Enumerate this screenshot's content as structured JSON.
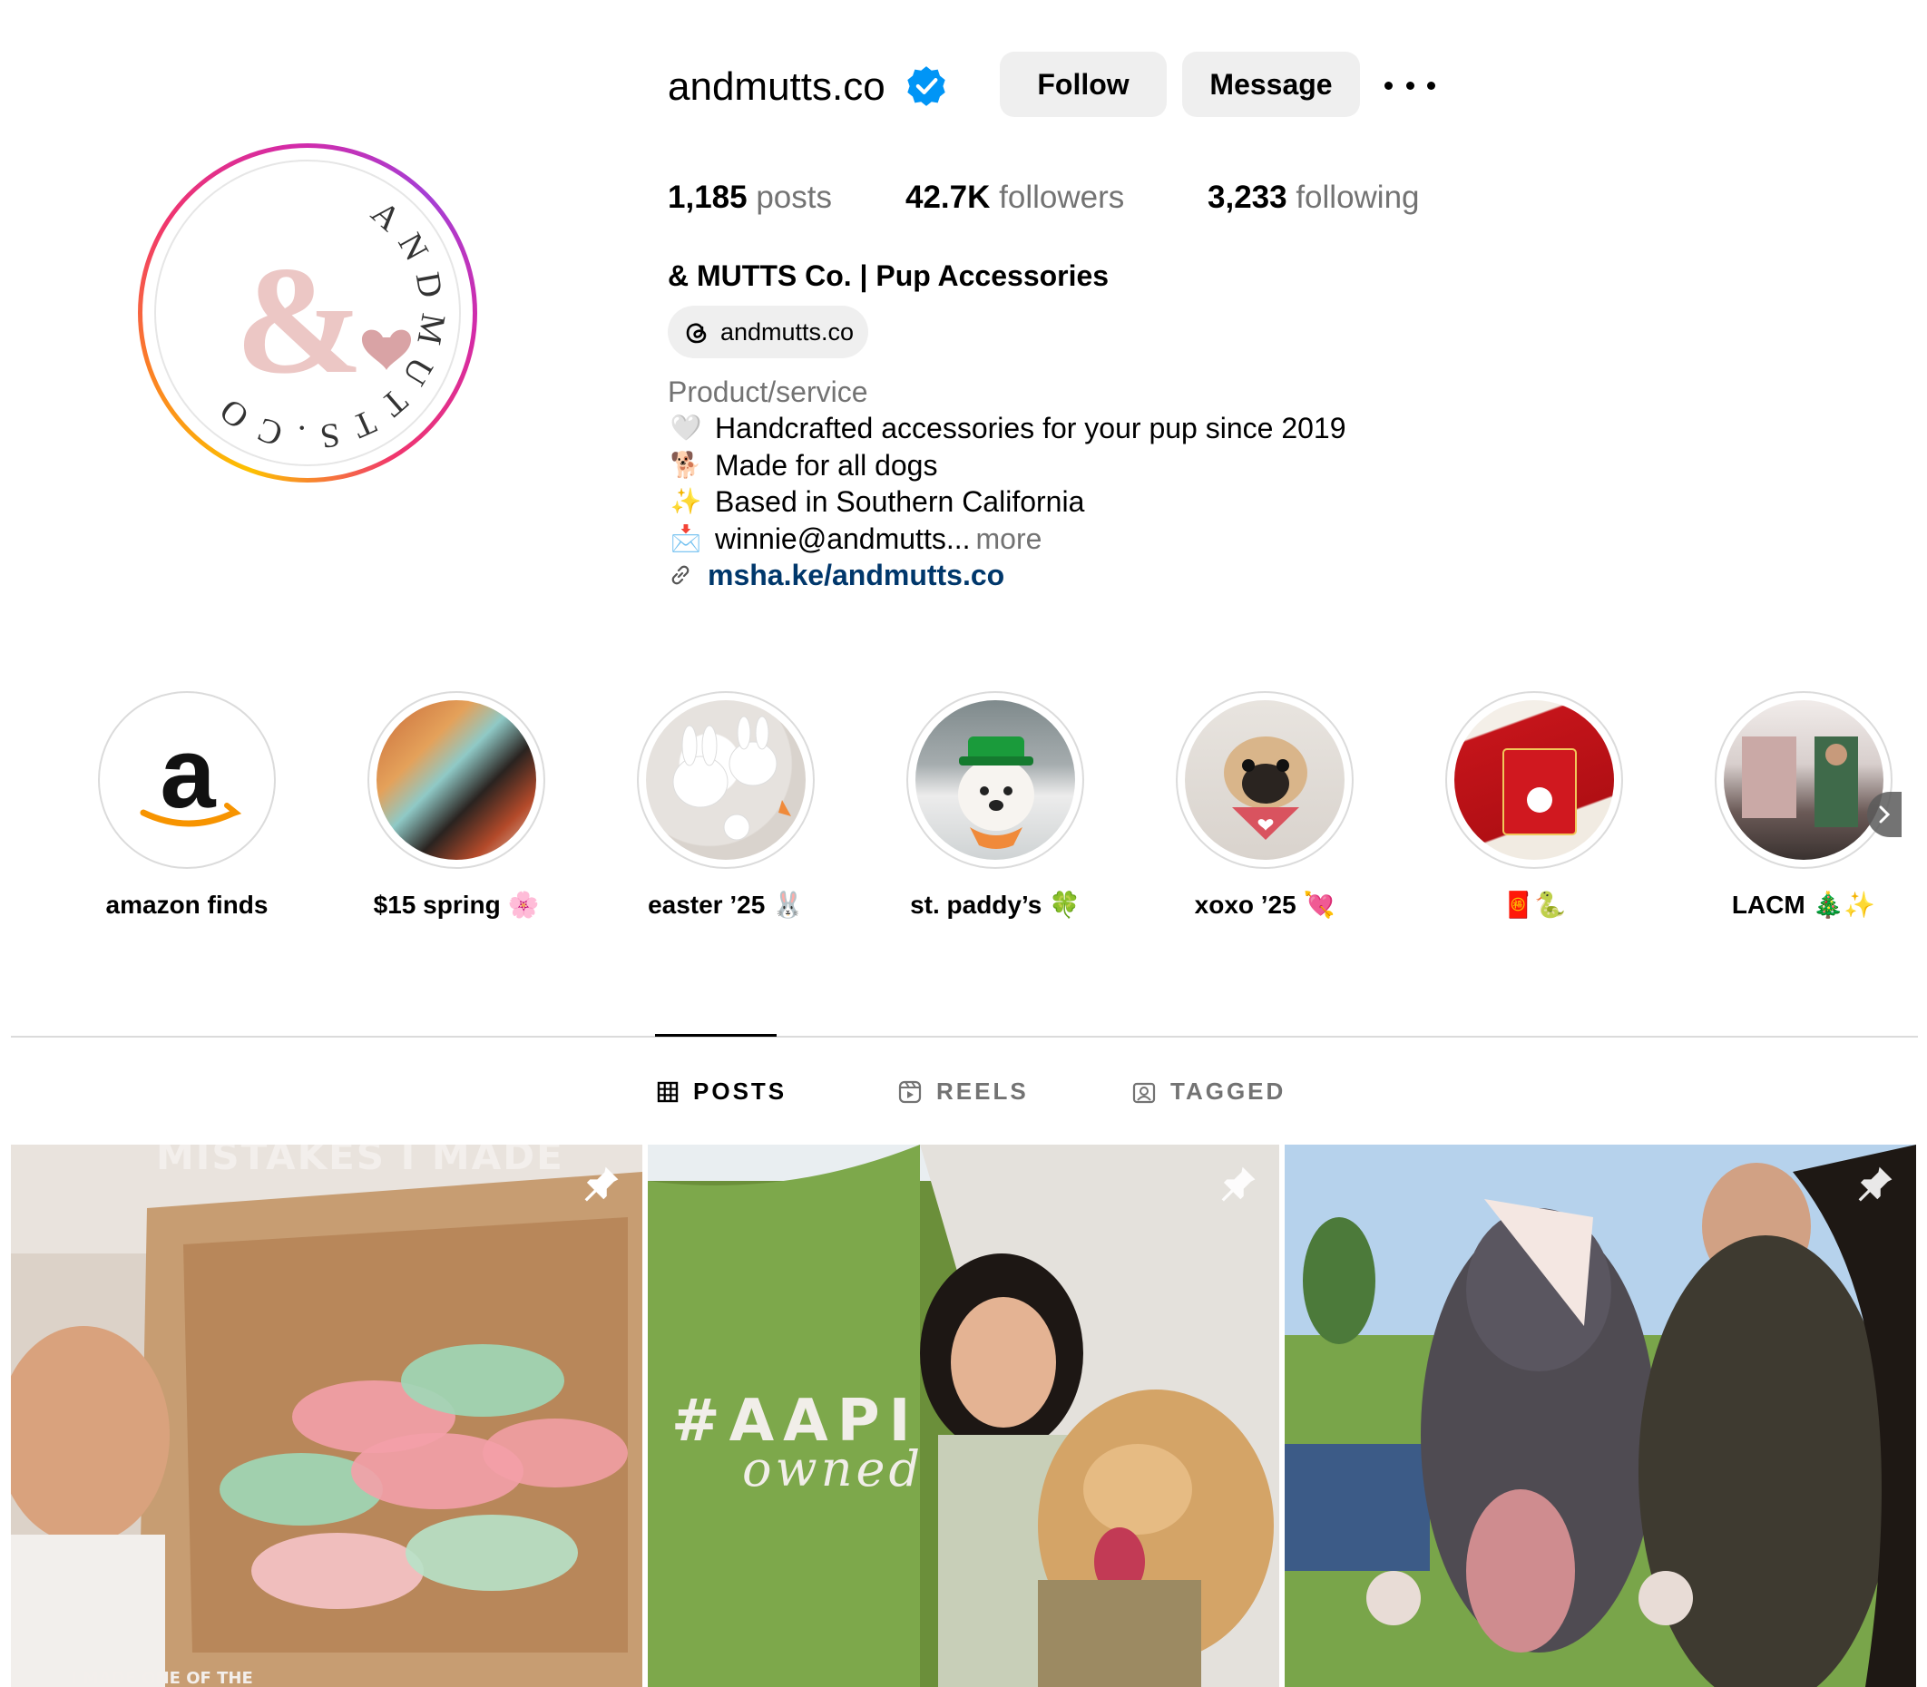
{
  "profile": {
    "username": "andmutts.co",
    "follow_label": "Follow",
    "message_label": "Message",
    "more_label": "More options",
    "avatar_ring_text": "ANDMUTTS.CO",
    "avatar_mark": "&",
    "stats": {
      "posts_count": "1,185",
      "posts_label": "posts",
      "followers_count": "42.7K",
      "followers_label": "followers",
      "following_count": "3,233",
      "following_label": "following"
    },
    "full_name": "& MUTTS Co. | Pup Accessories",
    "threads_handle": "andmutts.co",
    "category": "Product/service",
    "bio": [
      {
        "icon": "🤍",
        "text": "Handcrafted accessories for your pup since 2019"
      },
      {
        "icon": "🐕",
        "text": "Made for all dogs"
      },
      {
        "icon": "✨",
        "text": "Based in Southern California"
      },
      {
        "icon": "📩",
        "text": "winnie@andmutts...",
        "more": "more"
      }
    ],
    "link": "msha.ke/andmutts.co"
  },
  "highlights": [
    {
      "label": "amazon finds"
    },
    {
      "label": "$15 spring 🌸"
    },
    {
      "label": "easter ’25 🐰"
    },
    {
      "label": "st. paddy’s 🍀"
    },
    {
      "label": "xoxo ’25 💘"
    },
    {
      "label": "🧧🐍"
    },
    {
      "label": "LACM 🎄✨"
    }
  ],
  "tabs": [
    {
      "label": "POSTS",
      "active": true
    },
    {
      "label": "REELS",
      "active": false
    },
    {
      "label": "TAGGED",
      "active": false
    }
  ],
  "posts": [
    {
      "overlay_top": "MISTAKES I MADE",
      "overlay_bottom": "I MADE ONE OF THE",
      "pinned": true
    },
    {
      "overlay_text": "#AAPI",
      "overlay_script": "owned",
      "pinned": true
    },
    {
      "pinned": true
    }
  ],
  "colors": {
    "verified_blue": "#0095f6",
    "link_blue": "#00376b",
    "button_gray": "#efefef",
    "secondary_text": "#737373"
  }
}
